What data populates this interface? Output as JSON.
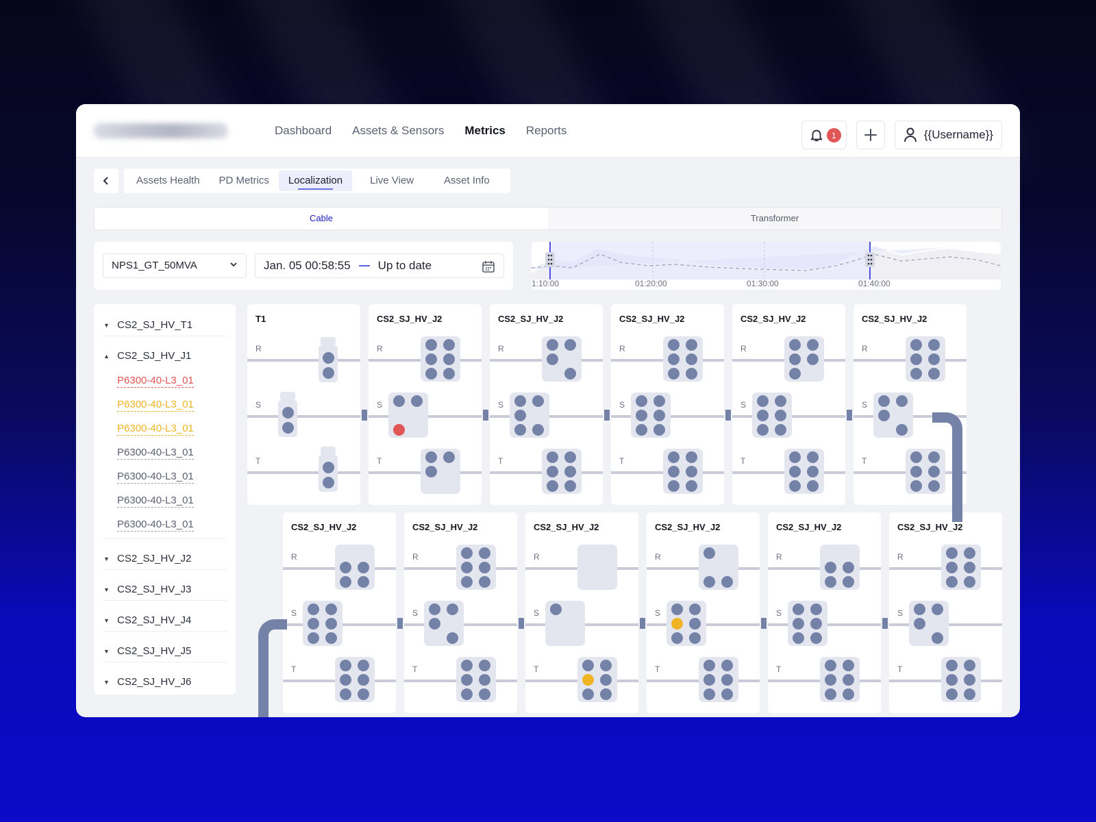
{
  "nav": {
    "items": [
      "Dashboard",
      "Assets & Sensors",
      "Metrics",
      "Reports"
    ],
    "active": 2
  },
  "header": {
    "notification_count": "1",
    "username": "{{Username}}"
  },
  "subtabs": {
    "items": [
      "Assets Health",
      "PD Metrics",
      "Localization",
      "Live View",
      "Asset Info"
    ],
    "active": 2
  },
  "segment": {
    "items": [
      "Cable",
      "Transformer"
    ],
    "active": 0
  },
  "filters": {
    "asset": "NPS1_GT_50MVA",
    "date_start": "Jan. 05 00:58:55",
    "date_end": "Up to date"
  },
  "timeline": {
    "labels": [
      "1:10:00",
      "01:20:00",
      "01:30:00",
      "01:40:00"
    ]
  },
  "tree": {
    "groups": [
      {
        "label": "CS2_SJ_HV_T1",
        "expanded": false
      },
      {
        "label": "CS2_SJ_HV_J1",
        "expanded": true,
        "children": [
          {
            "label": "P6300-40-L3_01",
            "status": "red"
          },
          {
            "label": "P6300-40-L3_01",
            "status": "yellow"
          },
          {
            "label": "P6300-40-L3_01",
            "status": "yellow"
          },
          {
            "label": "P6300-40-L3_01",
            "status": "normal"
          },
          {
            "label": "P6300-40-L3_01",
            "status": "normal"
          },
          {
            "label": "P6300-40-L3_01",
            "status": "normal"
          },
          {
            "label": "P6300-40-L3_01",
            "status": "normal"
          }
        ]
      },
      {
        "label": "CS2_SJ_HV_J2",
        "expanded": false
      },
      {
        "label": "CS2_SJ_HV_J3",
        "expanded": false
      },
      {
        "label": "CS2_SJ_HV_J4",
        "expanded": false
      },
      {
        "label": "CS2_SJ_HV_J5",
        "expanded": false
      },
      {
        "label": "CS2_SJ_HV_J6",
        "expanded": false
      }
    ]
  },
  "colors": {
    "alert_red": "#e05555",
    "alert_yellow": "#f0b324",
    "sensor": "#7582a8",
    "accent": "#1b1ec2"
  },
  "phase_labels": [
    "R",
    "S",
    "T"
  ],
  "cards_row1": [
    {
      "title": "T1",
      "kind": "terminal"
    },
    {
      "title": "CS2_SJ_HV_J2",
      "R": [
        1,
        1,
        1,
        1,
        1,
        1
      ],
      "S": [
        1,
        1,
        0,
        0,
        "red",
        0
      ],
      "T": [
        1,
        1,
        1,
        0,
        0,
        0
      ]
    },
    {
      "title": "CS2_SJ_HV_J2",
      "R": [
        1,
        1,
        1,
        0,
        0,
        1
      ],
      "S": [
        1,
        1,
        1,
        0,
        1,
        1
      ],
      "T": [
        1,
        1,
        1,
        1,
        1,
        1
      ]
    },
    {
      "title": "CS2_SJ_HV_J2",
      "R": [
        1,
        1,
        1,
        1,
        1,
        1
      ],
      "S": [
        1,
        1,
        1,
        1,
        1,
        1
      ],
      "T": [
        1,
        1,
        1,
        1,
        1,
        1
      ]
    },
    {
      "title": "CS2_SJ_HV_J2",
      "R": [
        1,
        1,
        1,
        1,
        1,
        0
      ],
      "S": [
        1,
        1,
        1,
        1,
        1,
        1
      ],
      "T": [
        1,
        1,
        1,
        1,
        1,
        1
      ]
    },
    {
      "title": "CS2_SJ_HV_J2",
      "R": [
        1,
        1,
        1,
        1,
        1,
        1
      ],
      "S": [
        1,
        1,
        1,
        0,
        0,
        1
      ],
      "T": [
        1,
        1,
        1,
        1,
        1,
        1
      ]
    }
  ],
  "cards_row2": [
    {
      "title": "CS2_SJ_HV_J2",
      "R": [
        0,
        0,
        1,
        1,
        1,
        1
      ],
      "S": [
        1,
        1,
        1,
        1,
        1,
        1
      ],
      "T": [
        1,
        1,
        1,
        1,
        1,
        1
      ]
    },
    {
      "title": "CS2_SJ_HV_J2",
      "R": [
        1,
        1,
        1,
        1,
        1,
        1
      ],
      "S": [
        1,
        1,
        1,
        0,
        0,
        1
      ],
      "T": [
        1,
        1,
        1,
        1,
        1,
        1
      ]
    },
    {
      "title": "CS2_SJ_HV_J2",
      "R": [
        0,
        0,
        0,
        0,
        0,
        0
      ],
      "S": [
        1,
        0,
        0,
        0,
        0,
        0
      ],
      "T": [
        1,
        1,
        "yellow",
        1,
        1,
        1
      ]
    },
    {
      "title": "CS2_SJ_HV_J2",
      "R": [
        1,
        0,
        0,
        0,
        1,
        1
      ],
      "S": [
        1,
        1,
        "yellow",
        1,
        1,
        1
      ],
      "T": [
        1,
        1,
        1,
        1,
        1,
        1
      ]
    },
    {
      "title": "CS2_SJ_HV_J2",
      "R": [
        0,
        0,
        1,
        1,
        1,
        1
      ],
      "S": [
        1,
        1,
        1,
        1,
        1,
        1
      ],
      "T": [
        1,
        1,
        1,
        1,
        1,
        1
      ]
    },
    {
      "title": "CS2_SJ_HV_J2",
      "R": [
        1,
        1,
        1,
        1,
        1,
        1
      ],
      "S": [
        1,
        1,
        1,
        0,
        0,
        1
      ],
      "T": [
        1,
        1,
        1,
        1,
        1,
        1
      ]
    }
  ]
}
